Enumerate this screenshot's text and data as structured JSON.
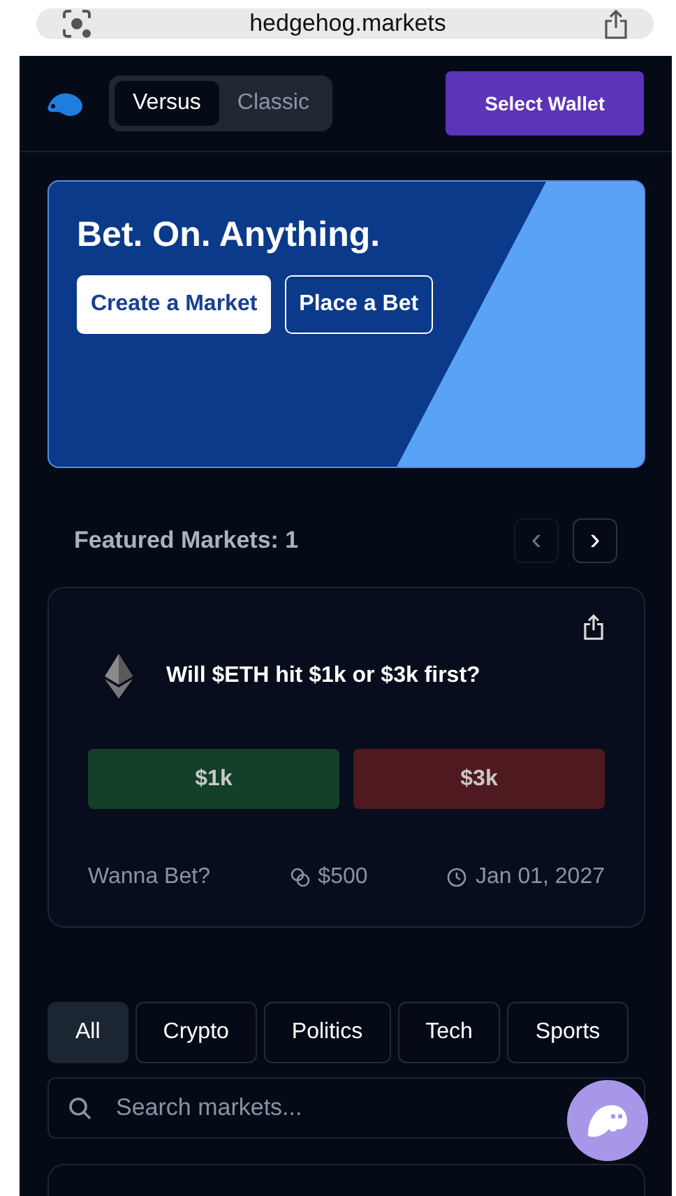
{
  "browser": {
    "url": "hedgehog.markets"
  },
  "header": {
    "modes": [
      {
        "label": "Versus",
        "selected": true
      },
      {
        "label": "Classic",
        "selected": false
      }
    ],
    "wallet_button": "Select Wallet"
  },
  "hero": {
    "title": "Bet. On. Anything.",
    "buttons": [
      {
        "label": "Create a Market",
        "kind": "primary"
      },
      {
        "label": "Place a Bet",
        "kind": "outline"
      }
    ]
  },
  "featured": {
    "title": "Featured Markets: 1",
    "nav": [
      {
        "label": "‹",
        "disabled": true
      },
      {
        "label": "›",
        "disabled": false
      }
    ]
  },
  "market": {
    "question": "Will $ETH hit $1k or $3k first?",
    "options": [
      {
        "label": "$1k",
        "color": "#14402a"
      },
      {
        "label": "$3k",
        "color": "#4f1a1f"
      }
    ],
    "footer": {
      "tag": "Wanna Bet?",
      "stake": "$500",
      "date": "Jan 01, 2027"
    }
  },
  "categories": [
    {
      "label": "All",
      "selected": true
    },
    {
      "label": "Crypto",
      "selected": false
    },
    {
      "label": "Politics",
      "selected": false
    },
    {
      "label": "Tech",
      "selected": false
    },
    {
      "label": "Sports",
      "selected": false
    }
  ],
  "search": {
    "placeholder": "Search markets..."
  }
}
